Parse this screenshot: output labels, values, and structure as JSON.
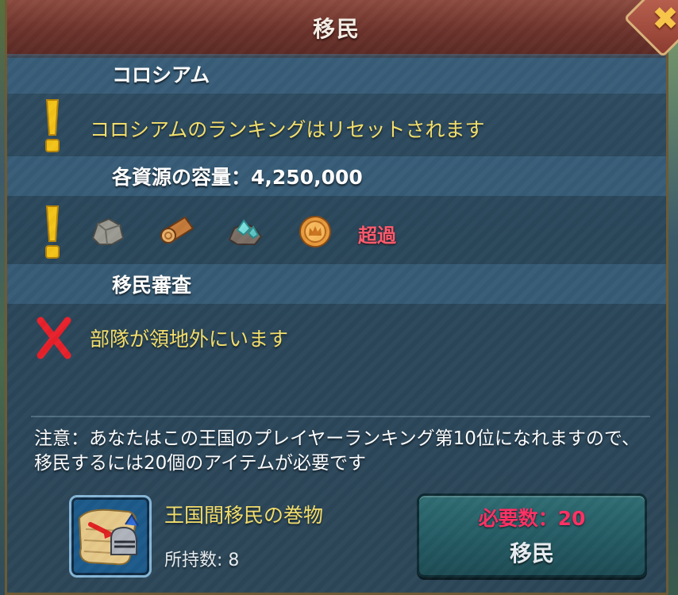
{
  "dialog": {
    "title": "移民"
  },
  "sections": {
    "colosseum": {
      "header": "コロシアム",
      "warning": "コロシアムのランキングはリセットされます"
    },
    "resources": {
      "header": "各資源の容量：4,250,000",
      "icons": [
        "stone-icon",
        "wood-icon",
        "ore-icon",
        "gold-icon"
      ],
      "status": "超過"
    },
    "review": {
      "header": "移民審査",
      "error": "部隊が領地外にいます"
    }
  },
  "notice": "注意：あなたはこの王国のプレイヤーランキング第10位になれますので、移民するには20個のアイテムが必要です",
  "item": {
    "name": "王国間移民の巻物",
    "owned": "所持数: 8",
    "icon": "scroll-knight-icon"
  },
  "migrate_button": {
    "required": "必要数：20",
    "label": "移民"
  },
  "colors": {
    "warning_yellow": "#f5df6a",
    "error_red": "#ff2f63",
    "status_over": "#ff5a6e",
    "title_bar": "#7a3d33"
  }
}
